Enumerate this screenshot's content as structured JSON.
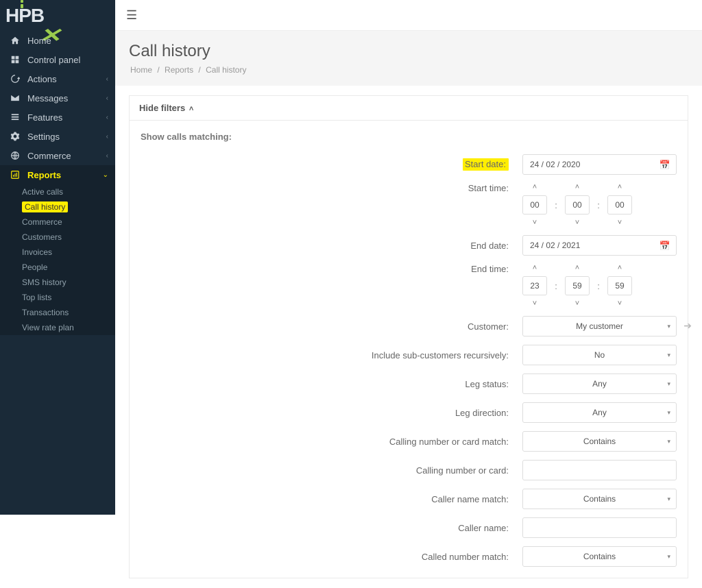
{
  "app": {
    "logo_h": "H",
    "logo_pbx": "PB",
    "logo_x": "X"
  },
  "sidebar": {
    "items": [
      {
        "icon": "home",
        "label": "Home",
        "type": "plain"
      },
      {
        "icon": "panel",
        "label": "Control panel",
        "type": "plain"
      },
      {
        "icon": "actions",
        "label": "Actions",
        "type": "expand"
      },
      {
        "icon": "messages",
        "label": "Messages",
        "type": "expand"
      },
      {
        "icon": "features",
        "label": "Features",
        "type": "expand"
      },
      {
        "icon": "settings",
        "label": "Settings",
        "type": "expand"
      },
      {
        "icon": "commerce",
        "label": "Commerce",
        "type": "expand"
      },
      {
        "icon": "reports",
        "label": "Reports",
        "type": "expanded",
        "active": true
      }
    ],
    "sub_reports": [
      {
        "label": "Active calls"
      },
      {
        "label": "Call history",
        "selected": true
      },
      {
        "label": "Commerce"
      },
      {
        "label": "Customers"
      },
      {
        "label": "Invoices"
      },
      {
        "label": "People"
      },
      {
        "label": "SMS history"
      },
      {
        "label": "Top lists"
      },
      {
        "label": "Transactions"
      },
      {
        "label": "View rate plan"
      }
    ]
  },
  "header": {
    "title": "Call history",
    "breadcrumb": [
      "Home",
      "Reports",
      "Call history"
    ]
  },
  "panel": {
    "toggle_label": "Hide filters",
    "section_label": "Show calls matching:"
  },
  "filters": {
    "start_date": {
      "label": "Start date:",
      "value": "24 / 02 / 2020"
    },
    "start_time": {
      "label": "Start time:",
      "h": "00",
      "m": "00",
      "s": "00"
    },
    "end_date": {
      "label": "End date:",
      "value": "24 / 02 / 2021"
    },
    "end_time": {
      "label": "End time:",
      "h": "23",
      "m": "59",
      "s": "59"
    },
    "customer": {
      "label": "Customer:",
      "value": "My customer"
    },
    "include_sub": {
      "label": "Include sub-customers recursively:",
      "value": "No"
    },
    "leg_status": {
      "label": "Leg status:",
      "value": "Any"
    },
    "leg_direction": {
      "label": "Leg direction:",
      "value": "Any"
    },
    "calling_match": {
      "label": "Calling number or card match:",
      "value": "Contains"
    },
    "calling_value": {
      "label": "Calling number or card:",
      "value": ""
    },
    "caller_name_match": {
      "label": "Caller name match:",
      "value": "Contains"
    },
    "caller_name": {
      "label": "Caller name:",
      "value": ""
    },
    "called_match": {
      "label": "Called number match:",
      "value": "Contains"
    }
  }
}
